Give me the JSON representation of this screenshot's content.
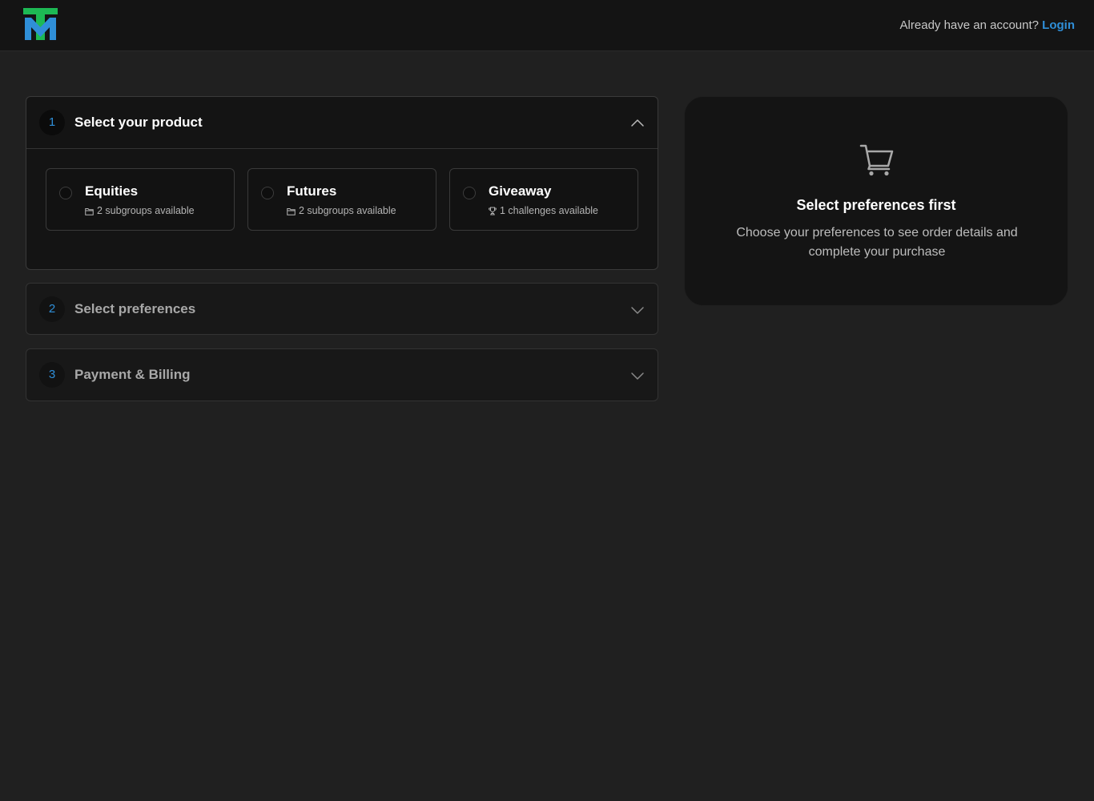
{
  "header": {
    "logo_icon": "tm-logo-icon",
    "account_prompt": "Already have an account?",
    "login_label": "Login"
  },
  "steps": [
    {
      "number": "1",
      "title": "Select your product",
      "expanded": true,
      "chevron": "chevron-up-icon"
    },
    {
      "number": "2",
      "title": "Select preferences",
      "expanded": false,
      "chevron": "chevron-down-icon"
    },
    {
      "number": "3",
      "title": "Payment & Billing",
      "expanded": false,
      "chevron": "chevron-down-icon"
    }
  ],
  "products": [
    {
      "name": "Equities",
      "subtext": "2 subgroups available",
      "icon": "folder-icon"
    },
    {
      "name": "Futures",
      "subtext": "2 subgroups available",
      "icon": "folder-icon"
    },
    {
      "name": "Giveaway",
      "subtext": "1 challenges available",
      "icon": "trophy-icon"
    }
  ],
  "summary": {
    "icon": "shopping-cart-icon",
    "title": "Select preferences first",
    "description": "Choose your preferences to see order details and complete your purchase"
  },
  "colors": {
    "background": "#202020",
    "topbar": "#141414",
    "accent": "#2f8fd8",
    "logo_green": "#1db954",
    "logo_blue": "#2f8fd8"
  }
}
